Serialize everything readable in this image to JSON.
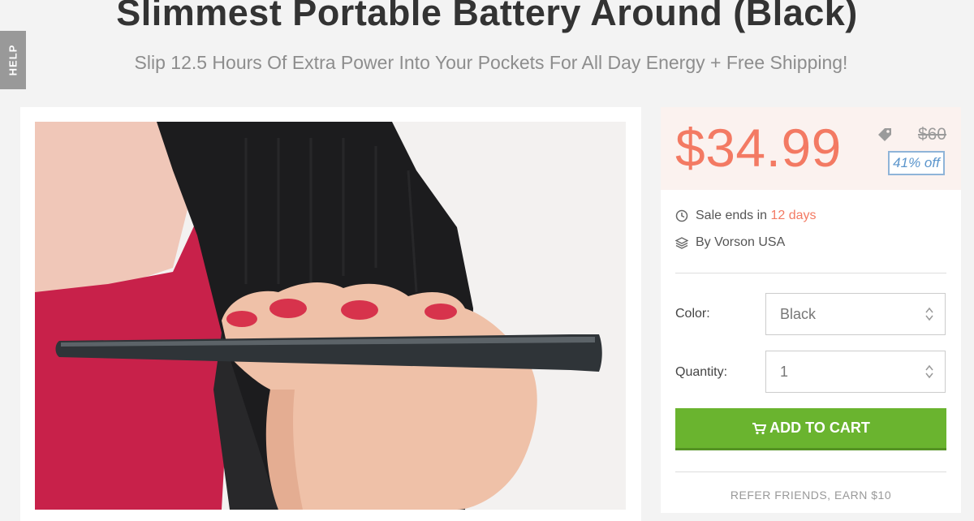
{
  "header": {
    "title": "Slimmest Portable Battery Around (Black)",
    "subtitle": "Slip 12.5 Hours Of Extra Power Into Your Pockets For All Day Energy + Free Shipping!"
  },
  "help_tab": {
    "label": "HELP"
  },
  "pricing": {
    "price": "$34.99",
    "original_price": "$60",
    "discount": "41% off",
    "price_color": "#f37a63"
  },
  "deal_info": {
    "sale_ends_prefix": "Sale ends in ",
    "sale_ends_value": "12 days",
    "vendor": "By Vorson USA"
  },
  "options": {
    "color_label": "Color:",
    "color_value": "Black",
    "quantity_label": "Quantity:",
    "quantity_value": "1"
  },
  "cart": {
    "add_to_cart_label": "ADD TO CART",
    "button_color": "#6ab42f"
  },
  "referral": {
    "label": "REFER FRIENDS, EARN $10"
  },
  "icons": {
    "clock": "clock-icon",
    "layers": "layers-icon",
    "tag": "tag-icon",
    "cart": "cart-icon",
    "select_arrows": "sort-arrows-icon"
  }
}
